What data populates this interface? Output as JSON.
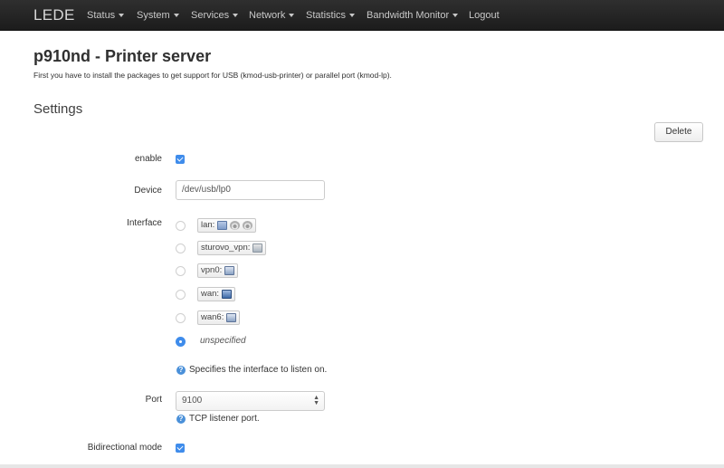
{
  "navbar": {
    "brand": "LEDE",
    "items": [
      {
        "label": "Status",
        "dropdown": true
      },
      {
        "label": "System",
        "dropdown": true
      },
      {
        "label": "Services",
        "dropdown": true
      },
      {
        "label": "Network",
        "dropdown": true
      },
      {
        "label": "Statistics",
        "dropdown": true
      },
      {
        "label": "Bandwidth Monitor",
        "dropdown": true
      },
      {
        "label": "Logout",
        "dropdown": false
      }
    ]
  },
  "page": {
    "title": "p910nd - Printer server",
    "description": "First you have to install the packages to get support for USB (kmod-usb-printer) or parallel port (kmod-lp)."
  },
  "settings": {
    "title": "Settings",
    "delete_label": "Delete",
    "enable": {
      "label": "enable",
      "checked": true
    },
    "device": {
      "label": "Device",
      "value": "/dev/usb/lp0"
    },
    "interface": {
      "label": "Interface",
      "options": [
        {
          "name": "lan:",
          "icons": [
            "switch-icon",
            "wifi-icon",
            "wifi-icon"
          ],
          "selected": false
        },
        {
          "name": "sturovo_vpn:",
          "icons": [
            "tunnel-icon"
          ],
          "selected": false
        },
        {
          "name": "vpn0:",
          "icons": [
            "ethernet-icon"
          ],
          "selected": false
        },
        {
          "name": "wan:",
          "icons": [
            "bridge-icon"
          ],
          "selected": false
        },
        {
          "name": "wan6:",
          "icons": [
            "ethernet-icon"
          ],
          "selected": false
        }
      ],
      "unspecified_label": "unspecified",
      "unspecified_selected": true,
      "help": "Specifies the interface to listen on."
    },
    "port": {
      "label": "Port",
      "value": "9100",
      "help": "TCP listener port."
    },
    "bidirectional": {
      "label": "Bidirectional mode",
      "checked": true
    }
  },
  "colors": {
    "navbar": "#222222",
    "accent": "#3f8ceb",
    "help": "#4a90d9"
  }
}
